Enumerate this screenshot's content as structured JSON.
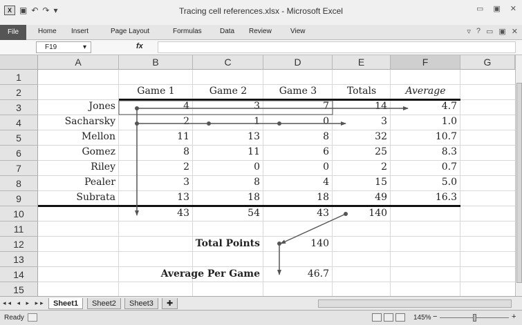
{
  "window": {
    "title": "Tracing cell references.xlsx - Microsoft Excel",
    "qat_icons": [
      "excel-logo",
      "save-icon",
      "undo-icon",
      "redo-icon",
      "customize-icon"
    ]
  },
  "ribbon": {
    "tabs": [
      "File",
      "Home",
      "Insert",
      "Page Layout",
      "Formulas",
      "Data",
      "Review",
      "View"
    ]
  },
  "formula_bar": {
    "name_box": "F19",
    "fx_label": "fx",
    "value": ""
  },
  "columns": [
    "A",
    "B",
    "C",
    "D",
    "E",
    "F",
    "G"
  ],
  "rows": [
    "1",
    "2",
    "3",
    "4",
    "5",
    "6",
    "7",
    "8",
    "9",
    "10",
    "11",
    "12",
    "13",
    "14",
    "15"
  ],
  "headers": {
    "game1": "Game 1",
    "game2": "Game 2",
    "game3": "Game 3",
    "totals": "Totals",
    "average": "Average"
  },
  "players": [
    {
      "name": "Jones",
      "g1": "4",
      "g2": "3",
      "g3": "7",
      "total": "14",
      "avg": "4.7"
    },
    {
      "name": "Sacharsky",
      "g1": "2",
      "g2": "1",
      "g3": "0",
      "total": "3",
      "avg": "1.0"
    },
    {
      "name": "Mellon",
      "g1": "11",
      "g2": "13",
      "g3": "8",
      "total": "32",
      "avg": "10.7"
    },
    {
      "name": "Gomez",
      "g1": "8",
      "g2": "11",
      "g3": "6",
      "total": "25",
      "avg": "8.3"
    },
    {
      "name": "Riley",
      "g1": "2",
      "g2": "0",
      "g3": "0",
      "total": "2",
      "avg": "0.7"
    },
    {
      "name": "Pealer",
      "g1": "3",
      "g2": "8",
      "g3": "4",
      "total": "15",
      "avg": "5.0"
    },
    {
      "name": "Subrata",
      "g1": "13",
      "g2": "18",
      "g3": "18",
      "total": "49",
      "avg": "16.3"
    }
  ],
  "totals_row": {
    "g1": "43",
    "g2": "54",
    "g3": "43",
    "total": "140"
  },
  "summary": {
    "total_points_label": "Total Points",
    "total_points_value": "140",
    "avg_label": "Average Per Game",
    "avg_value": "46.7"
  },
  "sheet_tabs": [
    "Sheet1",
    "Sheet2",
    "Sheet3"
  ],
  "status": {
    "ready": "Ready",
    "zoom": "145%",
    "zoom_minus": "−",
    "zoom_plus": "+"
  },
  "colors": {
    "arrow": "#555555",
    "header_border": "#111111"
  }
}
